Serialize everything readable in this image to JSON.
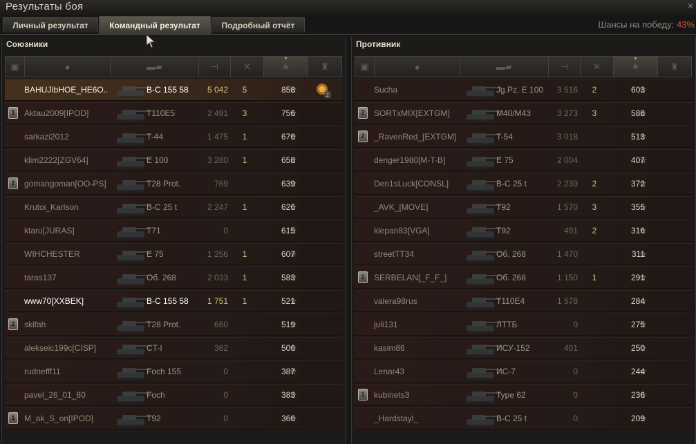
{
  "window": {
    "title": "Результаты боя",
    "close_glyph": "×"
  },
  "tabs": [
    {
      "label": "Личный результат",
      "active": false
    },
    {
      "label": "Командный результат",
      "active": true
    },
    {
      "label": "Подробный отчёт",
      "active": false
    }
  ],
  "win_chance": {
    "label": "Шансы на победу:",
    "value": "43%"
  },
  "colors": {
    "accent_red": "#d0533a",
    "player_highlight": "#46301d",
    "frag_yellow": "#d6c472"
  },
  "column_icons": [
    "platoon-icon",
    "player-icon",
    "tank-icon",
    "damage-icon",
    "frags-icon",
    "xp-star-icon",
    "medal-icon"
  ],
  "allies": {
    "title": "Союзники",
    "rows": [
      {
        "platoon": "",
        "name": "BAHUJIbHOE_HE6O..",
        "vehicle": "B-C 155 58",
        "damage": "5 042",
        "frags": "5",
        "xp": "858",
        "style": "me",
        "medal": true
      },
      {
        "platoon": "1",
        "name": "Aktau2009[IPOD]",
        "vehicle": "T110E5",
        "damage": "2 491",
        "frags": "3",
        "xp": "756",
        "style": ""
      },
      {
        "platoon": "",
        "name": "sarkazi2012",
        "vehicle": "T-44",
        "damage": "1 475",
        "frags": "1",
        "xp": "676",
        "style": ""
      },
      {
        "platoon": "",
        "name": "klim2222[ZGV64]",
        "vehicle": "E 100",
        "damage": "3 280",
        "frags": "1",
        "xp": "658",
        "style": ""
      },
      {
        "platoon": "2",
        "name": "gomangoman[OO-PS]",
        "vehicle": "T28 Prot.",
        "damage": "769",
        "frags": "",
        "xp": "639",
        "style": ""
      },
      {
        "platoon": "",
        "name": "Krutoi_Karlson",
        "vehicle": "B-C 25 t",
        "damage": "2 247",
        "frags": "1",
        "xp": "626",
        "style": ""
      },
      {
        "platoon": "",
        "name": "ktaru[JURAS]",
        "vehicle": "T71",
        "damage": "0",
        "frags": "",
        "xp": "615",
        "style": ""
      },
      {
        "platoon": "",
        "name": "WIHCHESTER",
        "vehicle": "E 75",
        "damage": "1 256",
        "frags": "1",
        "xp": "607",
        "style": ""
      },
      {
        "platoon": "",
        "name": "taras137",
        "vehicle": "Об. 268",
        "damage": "2 033",
        "frags": "1",
        "xp": "583",
        "style": ""
      },
      {
        "platoon": "",
        "name": "www70[XXBEK]",
        "vehicle": "B-C 155 58",
        "damage": "1 751",
        "frags": "1",
        "xp": "521",
        "style": "bright"
      },
      {
        "platoon": "2",
        "name": "skifah",
        "vehicle": "T28 Prot.",
        "damage": "660",
        "frags": "",
        "xp": "519",
        "style": ""
      },
      {
        "platoon": "",
        "name": "alekseic199c[CISP]",
        "vehicle": "CT-I",
        "damage": "362",
        "frags": "",
        "xp": "506",
        "style": ""
      },
      {
        "platoon": "",
        "name": "rudnefff11",
        "vehicle": "Foch 155",
        "damage": "0",
        "frags": "",
        "xp": "387",
        "style": ""
      },
      {
        "platoon": "",
        "name": "pavel_26_01_80",
        "vehicle": "Foch",
        "damage": "0",
        "frags": "",
        "xp": "383",
        "style": ""
      },
      {
        "platoon": "1",
        "name": "M_ak_S_on[IPOD]",
        "vehicle": "T92",
        "damage": "0",
        "frags": "",
        "xp": "366",
        "style": ""
      }
    ]
  },
  "enemies": {
    "title": "Противник",
    "rows": [
      {
        "platoon": "",
        "name": "Sucha",
        "vehicle": "Jg.Pz. E 100",
        "damage": "3 516",
        "frags": "2",
        "xp": "603",
        "style": ""
      },
      {
        "platoon": "2",
        "name": "SORTxMIX[EXTGM]",
        "vehicle": "M40/M43",
        "damage": "3 273",
        "frags": "3",
        "xp": "588",
        "style": ""
      },
      {
        "platoon": "2",
        "name": "_RavenRed_[EXTGM]",
        "vehicle": "T-54",
        "damage": "3 018",
        "frags": "",
        "xp": "513",
        "style": ""
      },
      {
        "platoon": "",
        "name": "denger1980[M-T-B]",
        "vehicle": "E 75",
        "damage": "2 004",
        "frags": "",
        "xp": "407",
        "style": ""
      },
      {
        "platoon": "",
        "name": "Den1sLuck[CONSL]",
        "vehicle": "B-C 25 t",
        "damage": "2 239",
        "frags": "2",
        "xp": "372",
        "style": ""
      },
      {
        "platoon": "",
        "name": "_AVK_[MOVE]",
        "vehicle": "T92",
        "damage": "1 570",
        "frags": "3",
        "xp": "355",
        "style": ""
      },
      {
        "platoon": "",
        "name": "klepan83[VGA]",
        "vehicle": "T92",
        "damage": "491",
        "frags": "2",
        "xp": "316",
        "style": ""
      },
      {
        "platoon": "",
        "name": "streetTT34",
        "vehicle": "Об. 268",
        "damage": "1 470",
        "frags": "",
        "xp": "311",
        "style": ""
      },
      {
        "platoon": "1",
        "name": "SERBELAN[_F_F_]",
        "vehicle": "Об. 268",
        "damage": "1 150",
        "frags": "1",
        "xp": "291",
        "style": ""
      },
      {
        "platoon": "",
        "name": "valera98rus",
        "vehicle": "T110E4",
        "damage": "1 578",
        "frags": "",
        "xp": "284",
        "style": ""
      },
      {
        "platoon": "",
        "name": "juli131",
        "vehicle": "ЛТТБ",
        "damage": "0",
        "frags": "",
        "xp": "275",
        "style": ""
      },
      {
        "platoon": "",
        "name": "kasim86",
        "vehicle": "ИСУ-152",
        "damage": "401",
        "frags": "",
        "xp": "250",
        "style": ""
      },
      {
        "platoon": "",
        "name": "Lenar43",
        "vehicle": "ИС-7",
        "damage": "0",
        "frags": "",
        "xp": "244",
        "style": ""
      },
      {
        "platoon": "1",
        "name": "kubinets3",
        "vehicle": "Type 62",
        "damage": "0",
        "frags": "",
        "xp": "236",
        "style": ""
      },
      {
        "platoon": "",
        "name": "_Hardstayl_",
        "vehicle": "B-C 25 t",
        "damage": "0",
        "frags": "",
        "xp": "209",
        "style": ""
      }
    ]
  }
}
